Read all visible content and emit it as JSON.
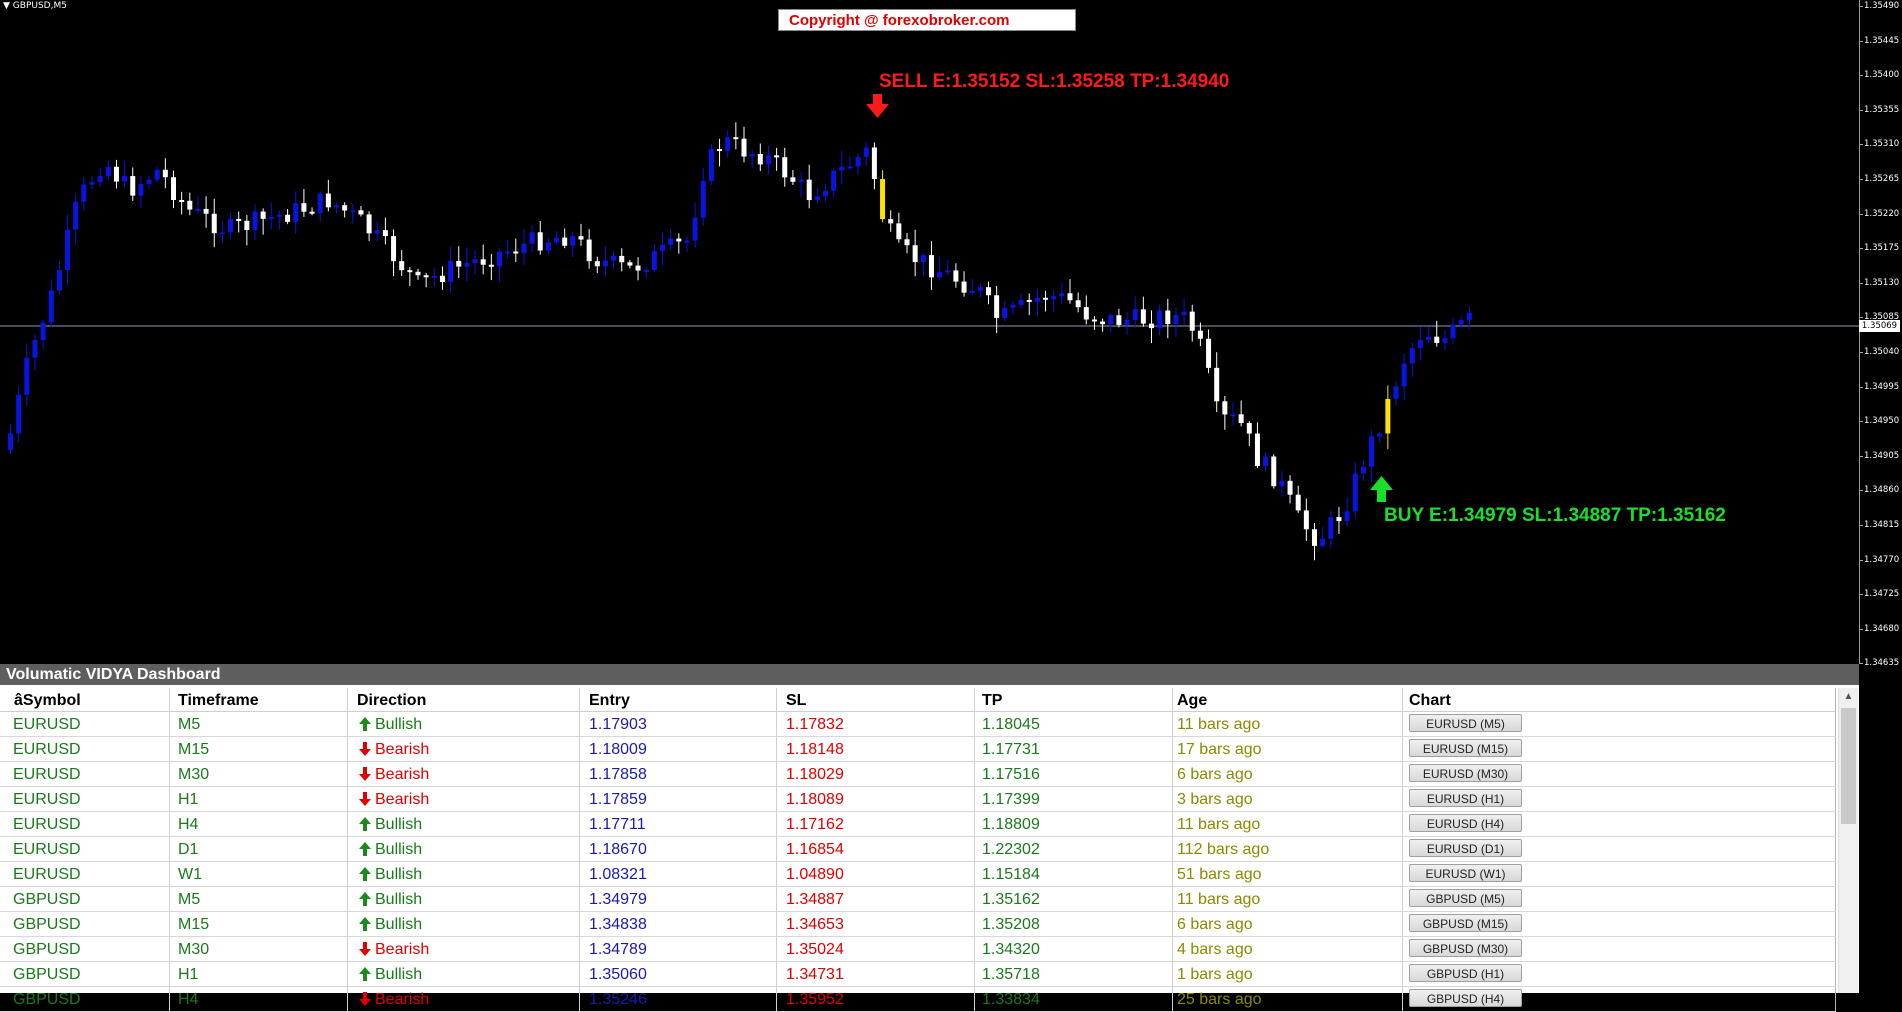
{
  "chart": {
    "symbol_label": "GBPUSD,M5",
    "copyright": "Copyright @ forexobroker.com",
    "sell_signal": "SELL E:1.35152 SL:1.35258 TP:1.34940",
    "buy_signal": "BUY E:1.34979 SL:1.34887 TP:1.35162",
    "current_price": "1.35069",
    "price_ticks": [
      "1.35490",
      "1.35445",
      "1.35400",
      "1.35355",
      "1.35310",
      "1.35265",
      "1.35220",
      "1.35175",
      "1.35130",
      "1.35085",
      "1.35040",
      "1.34995",
      "1.34950",
      "1.34905",
      "1.34860",
      "1.34815",
      "1.34770",
      "1.34725",
      "1.34680",
      "1.34635"
    ],
    "colors": {
      "bull": "#0a14e0",
      "bear": "#ffffff",
      "signal_candle": "#ffe000",
      "sell_arrow": "#ff1a1a",
      "buy_arrow": "#18e02a",
      "price_line": "#8a9ab0"
    }
  },
  "dashboard": {
    "title": "Volumatic VIDYA Dashboard",
    "headers": {
      "symbol": "âSymbol",
      "timeframe": "Timeframe",
      "direction": "Direction",
      "entry": "Entry",
      "sl": "SL",
      "tp": "TP",
      "age": "Age",
      "chart": "Chart"
    },
    "rows": [
      {
        "symbol": "EURUSD",
        "tf": "M5",
        "dir": "Bullish",
        "entry": "1.17903",
        "sl": "1.17832",
        "tp": "1.18045",
        "age": "11 bars ago",
        "chart": "EURUSD (M5)"
      },
      {
        "symbol": "EURUSD",
        "tf": "M15",
        "dir": "Bearish",
        "entry": "1.18009",
        "sl": "1.18148",
        "tp": "1.17731",
        "age": "17 bars ago",
        "chart": "EURUSD (M15)"
      },
      {
        "symbol": "EURUSD",
        "tf": "M30",
        "dir": "Bearish",
        "entry": "1.17858",
        "sl": "1.18029",
        "tp": "1.17516",
        "age": "6 bars ago",
        "chart": "EURUSD (M30)"
      },
      {
        "symbol": "EURUSD",
        "tf": "H1",
        "dir": "Bearish",
        "entry": "1.17859",
        "sl": "1.18089",
        "tp": "1.17399",
        "age": "3 bars ago",
        "chart": "EURUSD (H1)"
      },
      {
        "symbol": "EURUSD",
        "tf": "H4",
        "dir": "Bullish",
        "entry": "1.17711",
        "sl": "1.17162",
        "tp": "1.18809",
        "age": "11 bars ago",
        "chart": "EURUSD (H4)"
      },
      {
        "symbol": "EURUSD",
        "tf": "D1",
        "dir": "Bullish",
        "entry": "1.18670",
        "sl": "1.16854",
        "tp": "1.22302",
        "age": "112 bars ago",
        "chart": "EURUSD (D1)"
      },
      {
        "symbol": "EURUSD",
        "tf": "W1",
        "dir": "Bullish",
        "entry": "1.08321",
        "sl": "1.04890",
        "tp": "1.15184",
        "age": "51 bars ago",
        "chart": "EURUSD (W1)"
      },
      {
        "symbol": "GBPUSD",
        "tf": "M5",
        "dir": "Bullish",
        "entry": "1.34979",
        "sl": "1.34887",
        "tp": "1.35162",
        "age": "11 bars ago",
        "chart": "GBPUSD (M5)"
      },
      {
        "symbol": "GBPUSD",
        "tf": "M15",
        "dir": "Bullish",
        "entry": "1.34838",
        "sl": "1.34653",
        "tp": "1.35208",
        "age": "6 bars ago",
        "chart": "GBPUSD (M15)"
      },
      {
        "symbol": "GBPUSD",
        "tf": "M30",
        "dir": "Bearish",
        "entry": "1.34789",
        "sl": "1.35024",
        "tp": "1.34320",
        "age": "4 bars ago",
        "chart": "GBPUSD (M30)"
      },
      {
        "symbol": "GBPUSD",
        "tf": "H1",
        "dir": "Bullish",
        "entry": "1.35060",
        "sl": "1.34731",
        "tp": "1.35718",
        "age": "1 bars ago",
        "chart": "GBPUSD (H1)"
      },
      {
        "symbol": "GBPUSD",
        "tf": "H4",
        "dir": "Bearish",
        "entry": "1.35246",
        "sl": "1.35952",
        "tp": "1.33834",
        "age": "25 bars ago",
        "chart": "GBPUSD (H4)"
      }
    ]
  }
}
